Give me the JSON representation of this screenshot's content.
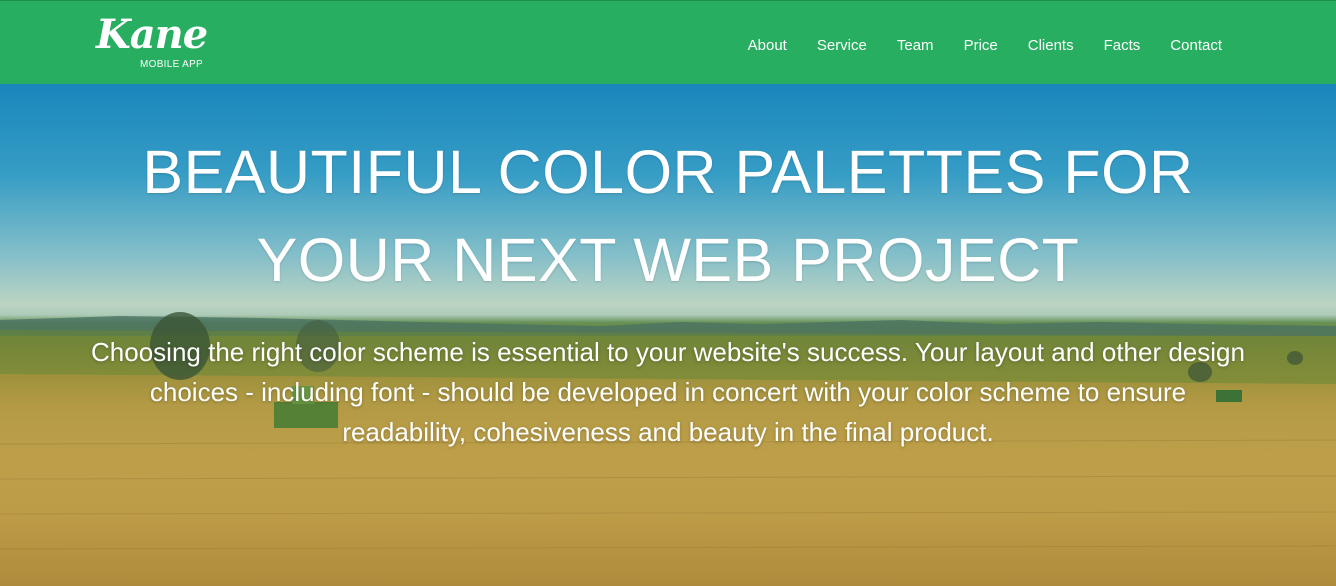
{
  "brand": {
    "logo_text": "Kane",
    "tagline": "MOBILE APP"
  },
  "nav": {
    "items": [
      {
        "label": "About"
      },
      {
        "label": "Service"
      },
      {
        "label": "Team"
      },
      {
        "label": "Price"
      },
      {
        "label": "Clients"
      },
      {
        "label": "Facts"
      },
      {
        "label": "Contact"
      }
    ]
  },
  "hero": {
    "title_line1": "BEAUTIFUL COLOR PALETTES FOR",
    "title_line2": "YOUR NEXT WEB PROJECT",
    "description": "Choosing the right color scheme is essential to your website's success. Your layout and other design choices - including font - should be developed in concert with your color scheme to ensure readability, cohesiveness and beauty in the final product."
  },
  "colors": {
    "navbar": "#27ae60",
    "text": "#ffffff",
    "sky": "#1a8fc8",
    "wheat": "#c9a64c"
  }
}
